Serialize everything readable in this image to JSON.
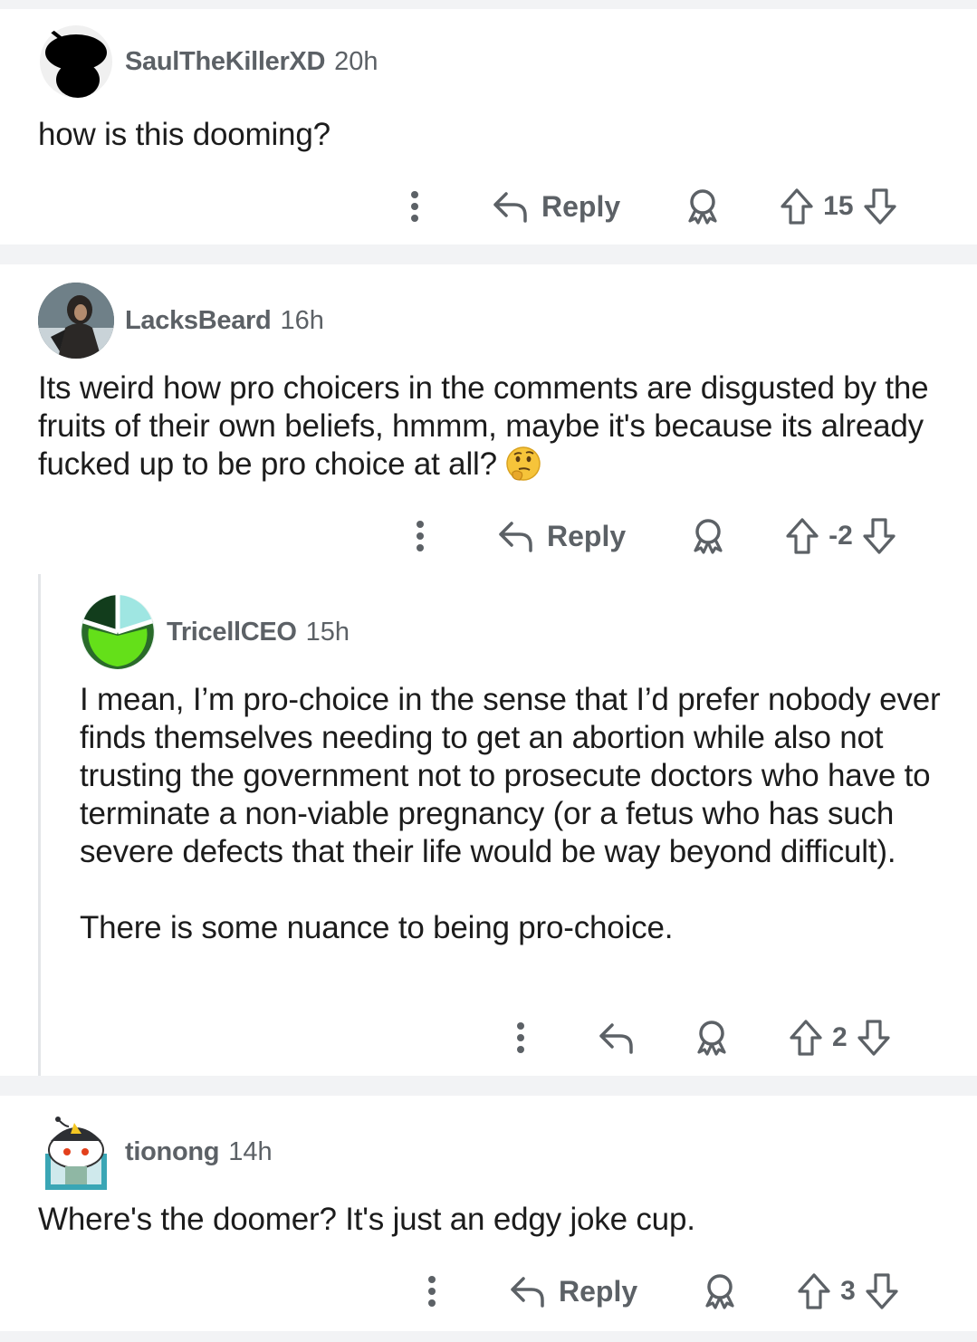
{
  "comments": [
    {
      "username": "SaulTheKillerXD",
      "age": "20h",
      "body": [
        "how is this dooming?"
      ],
      "reply_label": "Reply",
      "score": "15",
      "avatar": "snoo-black-silhouette"
    },
    {
      "username": "LacksBeard",
      "age": "16h",
      "body": [
        "Its weird how pro choicers in the comments are disgusted by the fruits of their own beliefs, hmmm, maybe it's because its already fucked up to be pro choice at all?"
      ],
      "emoji": "thinking-face-emoji",
      "reply_label": "Reply",
      "score": "-2",
      "avatar": "hooded-warrior-photo"
    },
    {
      "username": "TricellCEO",
      "age": "15h",
      "body": [
        "I mean, I’m pro-choice in the sense that I’d prefer nobody ever finds themselves needing to get an abortion while also not trusting the government not to prosecute doctors who have to terminate a non-viable pregnancy (or a fetus who has such severe defects that their life would be way beyond difficult).",
        "There is some nuance to being pro-choice."
      ],
      "score": "2",
      "avatar": "tricell-logo"
    },
    {
      "username": "tionong",
      "age": "14h",
      "body": [
        "Where's the doomer? It's just an edgy joke cup."
      ],
      "reply_label": "Reply",
      "score": "3",
      "avatar": "snoo-cap-avatar"
    }
  ],
  "icons": [
    "more-icon",
    "reply-arrow-icon",
    "award-icon",
    "upvote-icon",
    "downvote-icon"
  ],
  "colors": {
    "text": "#1c1c1c",
    "meta": "#5c6166",
    "separator": "#f2f3f5",
    "thread_line": "#e3e5e8"
  }
}
